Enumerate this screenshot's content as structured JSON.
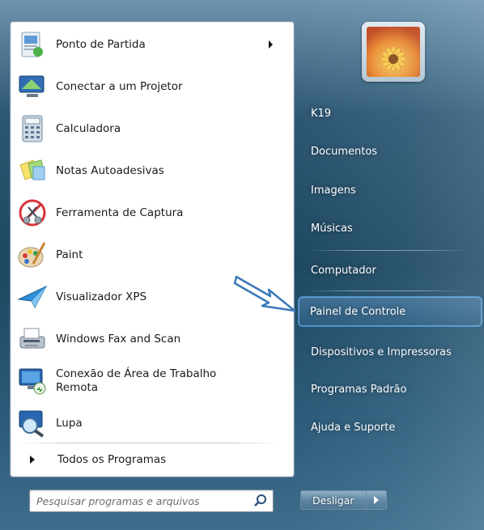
{
  "programs": [
    {
      "label": "Ponto de Partida",
      "icon": "getting-started-icon",
      "has_submenu": true
    },
    {
      "label": "Conectar a um Projetor",
      "icon": "projector-icon"
    },
    {
      "label": "Calculadora",
      "icon": "calculator-icon"
    },
    {
      "label": "Notas Autoadesivas",
      "icon": "sticky-notes-icon"
    },
    {
      "label": "Ferramenta de Captura",
      "icon": "snipping-tool-icon"
    },
    {
      "label": "Paint",
      "icon": "paint-icon"
    },
    {
      "label": "Visualizador XPS",
      "icon": "xps-viewer-icon"
    },
    {
      "label": "Windows Fax and Scan",
      "icon": "fax-scan-icon"
    },
    {
      "label_line1": "Conexão de Área de Trabalho",
      "label_line2": "Remota",
      "icon": "remote-desktop-icon"
    },
    {
      "label": "Lupa",
      "icon": "magnifier-icon"
    }
  ],
  "all_programs": {
    "label": "Todos os Programas"
  },
  "search": {
    "placeholder": "Pesquisar programas e arquivos"
  },
  "right": {
    "items": [
      {
        "label": "K19"
      },
      {
        "label": "Documentos"
      },
      {
        "label": "Imagens"
      },
      {
        "label": "Músicas"
      },
      {
        "label": "Computador"
      },
      {
        "label": "Painel de Controle",
        "highlighted": true
      },
      {
        "label": "Dispositivos e Impressoras"
      },
      {
        "label": "Programas Padrão"
      },
      {
        "label": "Ajuda e Suporte"
      }
    ]
  },
  "shutdown": {
    "label": "Desligar"
  },
  "colors": {
    "highlight_border": "#3b8fd6",
    "arrow": "#3a78b8",
    "panel_bg": "#ffffff"
  }
}
